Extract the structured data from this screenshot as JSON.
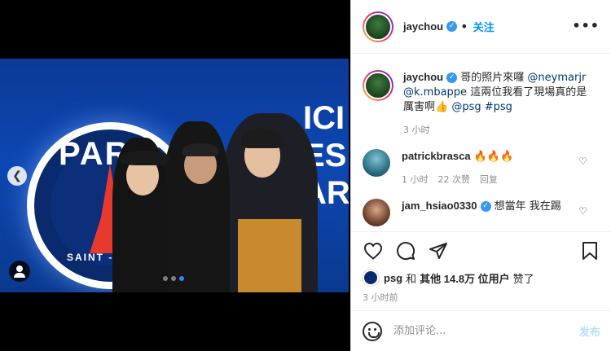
{
  "post": {
    "username": "jaychou",
    "follow_label": "关注",
    "more_label": "•••",
    "caption_text": "哥的照片來囉",
    "caption_mention1": "@neymarjr",
    "caption_mention2": "@k.mbappe",
    "caption_text2": "這兩位我看了現場真的是厲害啊👍",
    "caption_mention3": "@psg",
    "caption_tag": "#psg",
    "caption_time": "3 小时"
  },
  "photo": {
    "crest_top": "PARIS",
    "crest_bottom": "SAINT - GE",
    "wall_text_1": "ICI",
    "wall_text_2": "ES",
    "wall_text_3": "AR"
  },
  "comments": [
    {
      "username": "patrickbrasca",
      "text": "🔥🔥🔥",
      "time": "1 小时",
      "likes": "22 次赞",
      "reply": "回复"
    },
    {
      "username": "jam_hsiao0330",
      "text": "想當年 我在踢",
      "verified": true
    }
  ],
  "likes": {
    "prefix": "psg",
    "and": "和",
    "others": "其他 14.8万 位用户",
    "suffix": "赞了"
  },
  "post_time": "3 小时前",
  "comment_box": {
    "placeholder": "添加评论...",
    "post_label": "发布"
  },
  "colors": {
    "accent": "#0095f6",
    "verified": "#3897f0",
    "psg_blue": "#0a2a6e",
    "psg_red": "#e8392f"
  }
}
